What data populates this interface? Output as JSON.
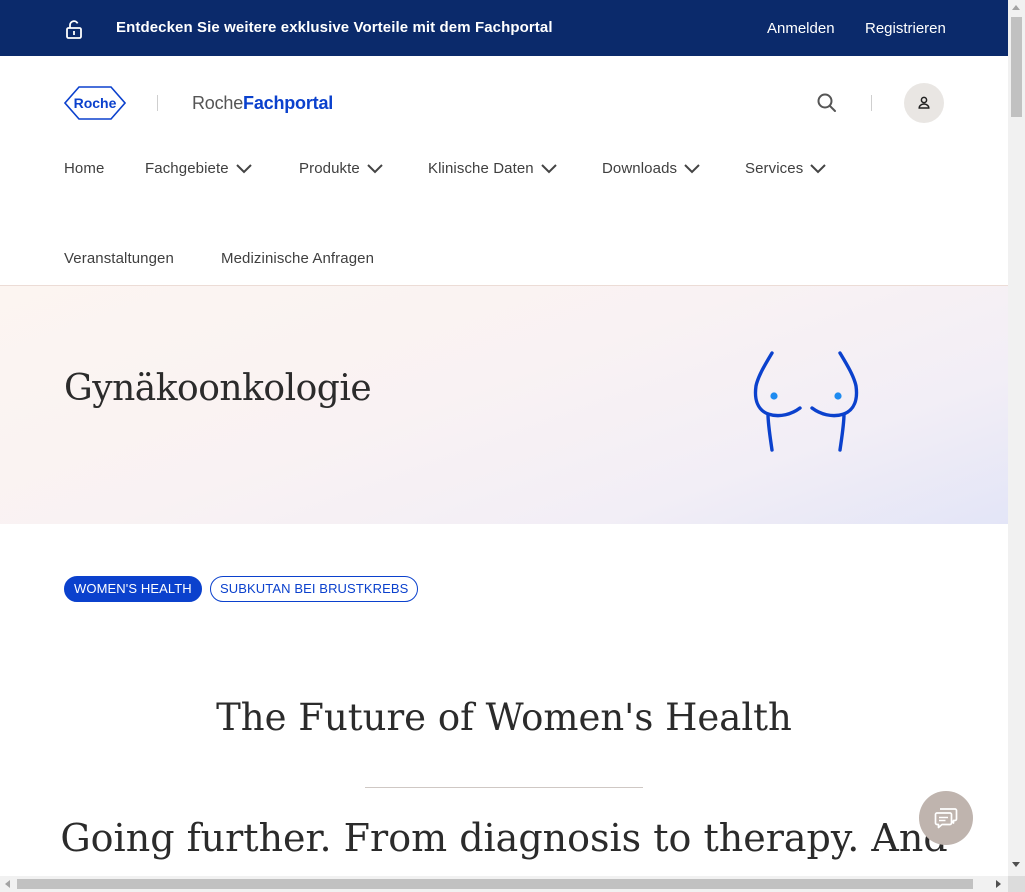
{
  "topbar": {
    "promo": "Entdecken Sie weitere exklusive Vorteile mit dem Fachportal",
    "login": "Anmelden",
    "register": "Registrieren",
    "icon": "lock-icon"
  },
  "header": {
    "logo_text": "Roche",
    "brand_light": "Roche",
    "brand_bold": "Fachportal",
    "icons": [
      "search-icon",
      "user-icon"
    ]
  },
  "nav": {
    "home": "Home",
    "fachgebiete": "Fachgebiete",
    "produkte": "Produkte",
    "klinische_daten": "Klinische Daten",
    "downloads": "Downloads",
    "services": "Services",
    "veranstaltungen": "Veranstaltungen",
    "anfragen": "Medizinische Anfragen"
  },
  "hero": {
    "title": "Gynäkoonkologie",
    "illustration": "breast-outline-icon"
  },
  "tags": [
    {
      "label": "WOMEN'S HEALTH",
      "active": true
    },
    {
      "label": "SUBKUTAN BEI BRUSTKREBS",
      "active": false
    }
  ],
  "content": {
    "heading": "The Future of Women's Health",
    "subheading": "Going further. From diagnosis to therapy. And"
  },
  "chat": {
    "icon": "chat-icon"
  },
  "colors": {
    "topbar_bg": "#0b2a6b",
    "accent": "#0b41cd",
    "chat_bg": "#bfb4ae"
  }
}
